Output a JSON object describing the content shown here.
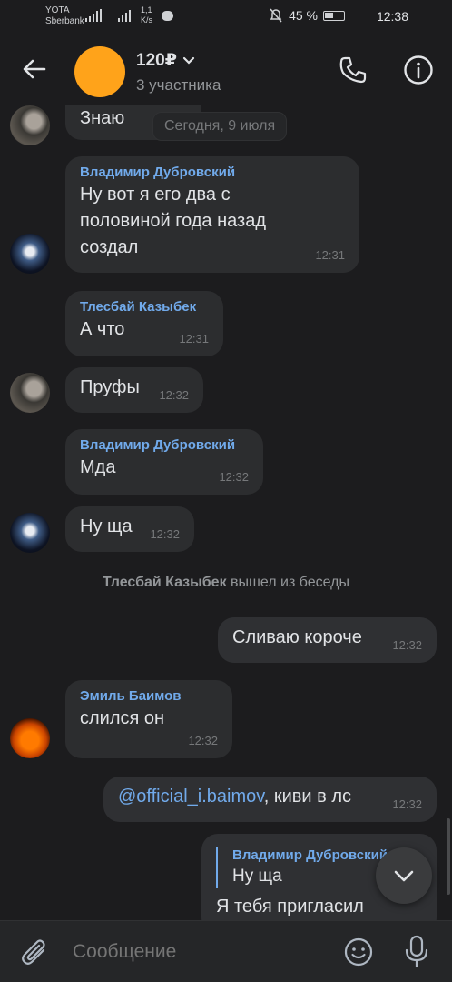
{
  "status_bar": {
    "carrier_top": "YOTA",
    "carrier_bottom": "Sberbank",
    "net_type": "4G",
    "speed_top": "1,1",
    "speed_bottom": "K/s",
    "battery": "45 %",
    "time": "12:38"
  },
  "header": {
    "title": "120₽",
    "subtitle": "3 участника",
    "avatar_color": "#ffa31a",
    "icons": [
      "back-arrow-icon",
      "phone-icon",
      "info-icon",
      "chevron-down-icon"
    ]
  },
  "messages": {
    "m1": {
      "text": "Знаю"
    },
    "date_pill": "Сегодня, 9 июля",
    "m2": {
      "sender": "Владимир Дубровский",
      "lines": [
        "Ну вот я его два с",
        "половиной года назад",
        "создал"
      ],
      "time": "12:31"
    },
    "m3": {
      "sender": "Тлесбай Казыбек",
      "text": "А что",
      "time": "12:31"
    },
    "m4": {
      "text": "Пруфы",
      "time": "12:32"
    },
    "m5": {
      "sender": "Владимир Дубровский",
      "text": "Мда",
      "time": "12:32"
    },
    "m6": {
      "text": "Ну ща",
      "time": "12:32"
    },
    "service": {
      "name": "Тлесбай Казыбек",
      "action": " вышел из беседы"
    },
    "m7": {
      "text": "Сливаю короче",
      "time": "12:32"
    },
    "m8": {
      "sender": "Эмиль Баимов",
      "text": "слился он",
      "time": "12:32"
    },
    "m9": {
      "mention": "@official_i.baimov",
      "text": ", киви в лс",
      "time": "12:32"
    },
    "m10": {
      "reply_sender": "Владимир Дубровский",
      "reply_text": "Ну ща",
      "text": "Я тебя пригласил"
    }
  },
  "composer": {
    "placeholder": "Сообщение"
  },
  "colors": {
    "background": "#1c1c1e",
    "bubble": "#2c2d2f",
    "accent": "#71aaeb",
    "muted": "#76787a"
  }
}
